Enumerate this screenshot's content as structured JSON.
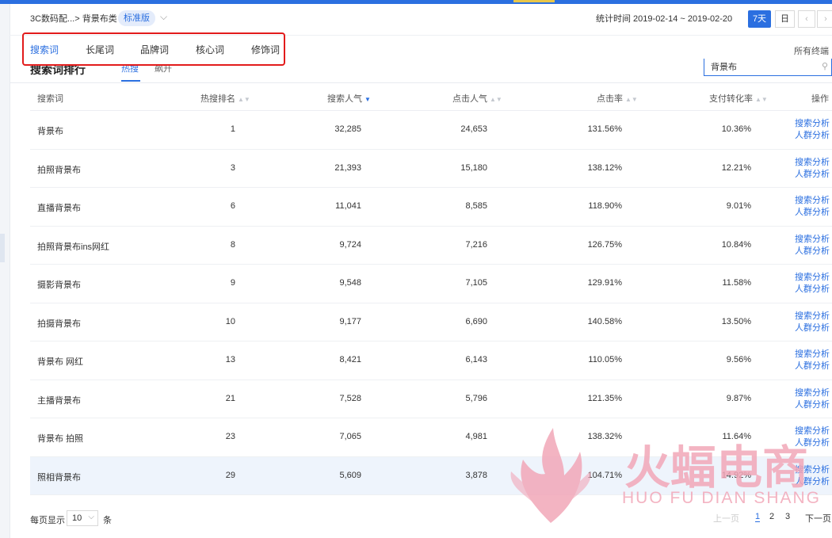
{
  "header": {
    "breadcrumb": "3C数码配...> 背景布类",
    "edition_badge": "标准版",
    "stat_time_label": "统计时间 2019-02-14 ~ 2019-02-20",
    "range_buttons": [
      "7天",
      "日"
    ]
  },
  "tabs": [
    "搜索词",
    "长尾词",
    "品牌词",
    "核心词",
    "修饰词"
  ],
  "active_tab": "搜索词",
  "all_terminals": "所有终端",
  "section": {
    "title": "搜索词排行",
    "subtabs": [
      "热搜",
      "飙升"
    ],
    "search_value": "背景布"
  },
  "table": {
    "columns": [
      "搜索词",
      "热搜排名",
      "搜索人气",
      "点击人气",
      "点击率",
      "支付转化率",
      "操作"
    ],
    "rows": [
      {
        "keyword": "背景布",
        "rank": "1",
        "search_popularity": "32,285",
        "click_popularity": "24,653",
        "ctr": "131.56%",
        "conversion": "10.36%"
      },
      {
        "keyword": "拍照背景布",
        "rank": "3",
        "search_popularity": "21,393",
        "click_popularity": "15,180",
        "ctr": "138.12%",
        "conversion": "12.21%"
      },
      {
        "keyword": "直播背景布",
        "rank": "6",
        "search_popularity": "11,041",
        "click_popularity": "8,585",
        "ctr": "118.90%",
        "conversion": "9.01%"
      },
      {
        "keyword": "拍照背景布ins网红",
        "rank": "8",
        "search_popularity": "9,724",
        "click_popularity": "7,216",
        "ctr": "126.75%",
        "conversion": "10.84%"
      },
      {
        "keyword": "摄影背景布",
        "rank": "9",
        "search_popularity": "9,548",
        "click_popularity": "7,105",
        "ctr": "129.91%",
        "conversion": "11.58%"
      },
      {
        "keyword": "拍摄背景布",
        "rank": "10",
        "search_popularity": "9,177",
        "click_popularity": "6,690",
        "ctr": "140.58%",
        "conversion": "13.50%"
      },
      {
        "keyword": "背景布 网红",
        "rank": "13",
        "search_popularity": "8,421",
        "click_popularity": "6,143",
        "ctr": "110.05%",
        "conversion": "9.56%"
      },
      {
        "keyword": "主播背景布",
        "rank": "21",
        "search_popularity": "7,528",
        "click_popularity": "5,796",
        "ctr": "121.35%",
        "conversion": "9.87%"
      },
      {
        "keyword": "背景布 拍照",
        "rank": "23",
        "search_popularity": "7,065",
        "click_popularity": "4,981",
        "ctr": "138.32%",
        "conversion": "11.64%"
      },
      {
        "keyword": "照相背景布",
        "rank": "29",
        "search_popularity": "5,609",
        "click_popularity": "3,878",
        "ctr": "104.71%",
        "conversion": "14.92%"
      }
    ],
    "action_labels": [
      "搜索分析",
      "人群分析"
    ]
  },
  "pagination": {
    "per_page_label": "每页显示",
    "per_page_value": "10",
    "unit": "条",
    "prev": "上一页",
    "pages": [
      "1",
      "2",
      "3"
    ],
    "current_page": "1",
    "next": "下一页"
  },
  "watermark": {
    "text_cn": "火蝠电商",
    "text_en": "HUO FU DIAN SHANG"
  },
  "colors": {
    "accent": "#2b6fe0",
    "highlight_box": "#e21b1b",
    "watermark": "#f2a7b8"
  }
}
